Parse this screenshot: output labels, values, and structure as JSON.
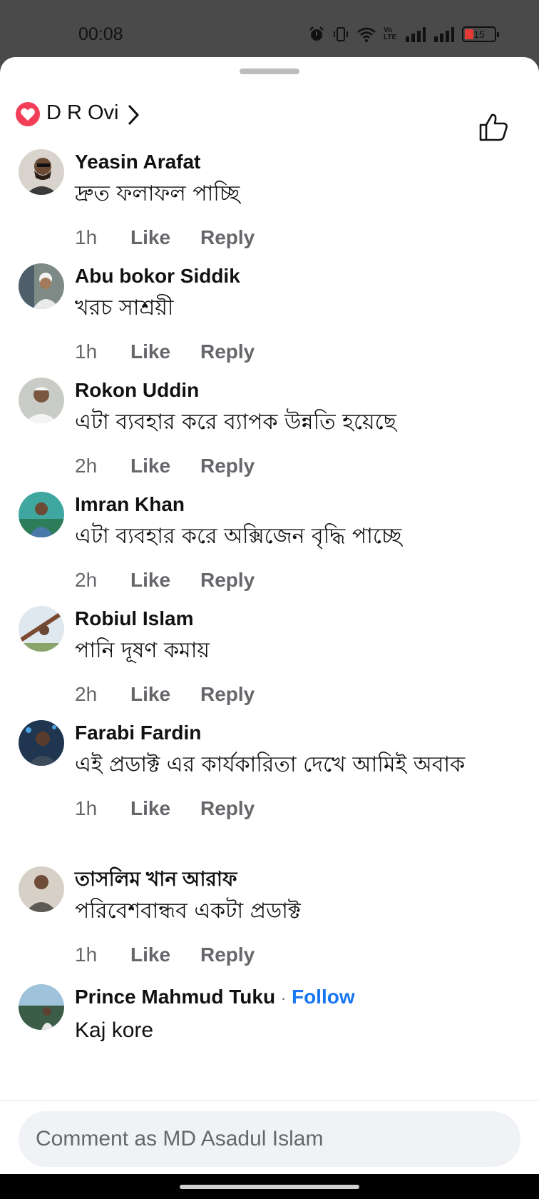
{
  "status_bar": {
    "time": "00:08",
    "battery_level": "15",
    "icons": [
      "alarm-icon",
      "vibrate-icon",
      "wifi-icon",
      "volte-icon",
      "signal-icon",
      "signal-icon",
      "battery-icon"
    ],
    "volte_label": "Vo LTE"
  },
  "header": {
    "reaction_icon": "heart-icon",
    "reactor_name": "D R Ovi",
    "like_icon": "thumbs-up-icon"
  },
  "colors": {
    "accent": "#1877f2",
    "heart": "#f33e58",
    "text": "#111111",
    "muted": "#65676b"
  },
  "actions": {
    "like": "Like",
    "reply": "Reply"
  },
  "comments": [
    {
      "author": "Yeasin Arafat",
      "text": "দ্রুত ফলাফল পাচ্ছি",
      "time": "1h"
    },
    {
      "author": "Abu bokor Siddik",
      "text": "খরচ সাশ্রয়ী",
      "time": "1h"
    },
    {
      "author": "Rokon Uddin",
      "text": "এটা ব্যবহার করে ব্যাপক উন্নতি হয়েছে",
      "time": "2h"
    },
    {
      "author": "Imran Khan",
      "text": "এটা ব্যবহার করে অক্সিজেন বৃদ্ধি পাচ্ছে",
      "time": "2h"
    },
    {
      "author": "Robiul Islam",
      "text": "পানি দূষণ কমায়",
      "time": "2h"
    },
    {
      "author": "Farabi Fardin",
      "text": "এই প্রডাক্ট এর কার্যকারিতা দেখে আমিই অবাক",
      "time": "1h"
    },
    {
      "author": "তাসলিম খান আরাফ",
      "text": "পরিবেশবান্ধব একটা প্রডাক্ট",
      "time": "1h"
    },
    {
      "author": "Prince Mahmud Tuku",
      "follow": "Follow",
      "separator": "·",
      "text": "Kaj kore"
    }
  ],
  "composer": {
    "placeholder": "Comment as MD Asadul Islam"
  }
}
